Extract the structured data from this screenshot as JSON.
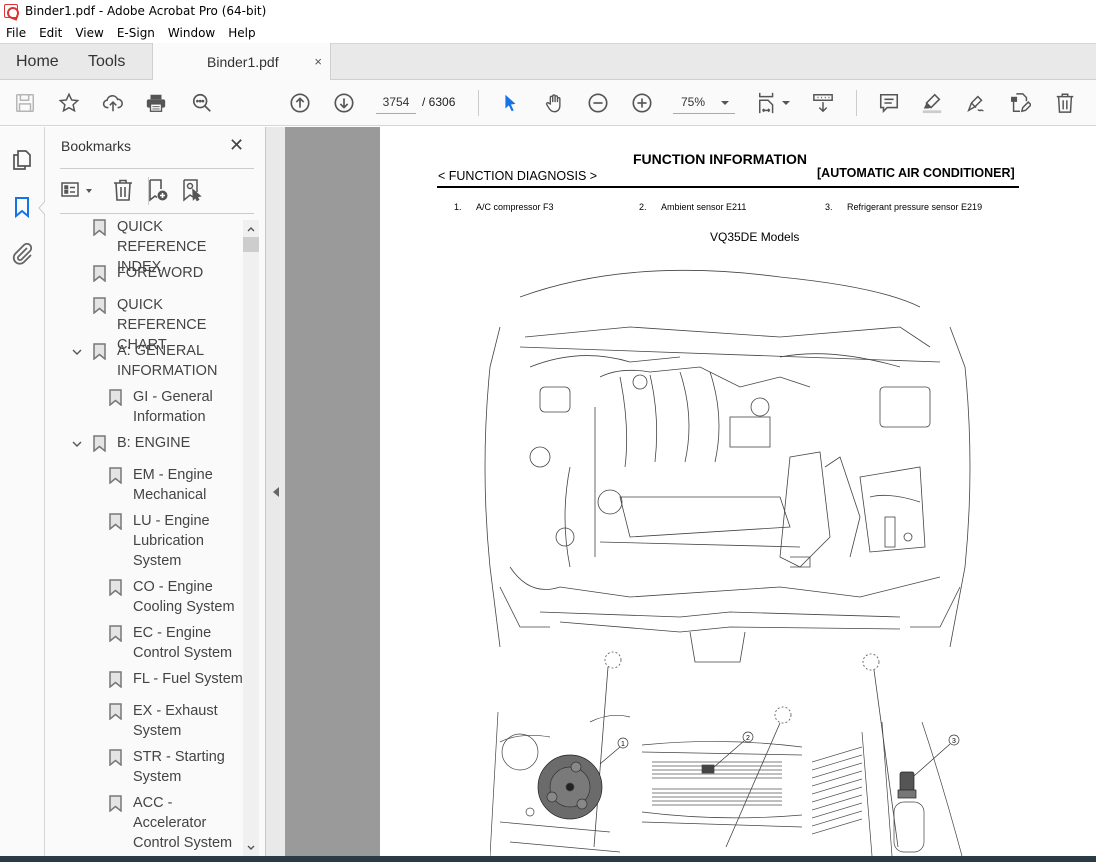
{
  "window": {
    "title": "Binder1.pdf - Adobe Acrobat Pro (64-bit)"
  },
  "menu": [
    "File",
    "Edit",
    "View",
    "E-Sign",
    "Window",
    "Help"
  ],
  "tabs": {
    "home": "Home",
    "tools": "Tools",
    "document": "Binder1.pdf",
    "close": "×"
  },
  "toolbar": {
    "current_page": "3754",
    "total_pages": "/  6306",
    "zoom": "75%",
    "icons": [
      "save-icon",
      "bookmark-star-icon",
      "upload-cloud-icon",
      "print-icon",
      "search-zoom-icon",
      "page-up-icon",
      "page-down-icon",
      "select-cursor-icon",
      "hand-icon",
      "zoom-out-icon",
      "zoom-in-icon",
      "fit-page-icon",
      "scroll-mode-icon",
      "comment-icon",
      "highlight-icon",
      "sign-icon",
      "edit-pdf-icon",
      "delete-icon"
    ]
  },
  "bookmarks": {
    "title": "Bookmarks",
    "close": "✕",
    "items": [
      {
        "label": "QUICK REFERENCE\nINDEX",
        "level": 0,
        "expandable": false
      },
      {
        "label": "FOREWORD",
        "level": 0,
        "expandable": false
      },
      {
        "label": "QUICK REFERENCE\nCHART",
        "level": 0,
        "expandable": false
      },
      {
        "label": "A: GENERAL\nINFORMATION",
        "level": 0,
        "expandable": true,
        "expanded": true
      },
      {
        "label": "GI - General\nInformation",
        "level": 1,
        "expandable": false
      },
      {
        "label": "B: ENGINE",
        "level": 0,
        "expandable": true,
        "expanded": true
      },
      {
        "label": "EM - Engine\nMechanical",
        "level": 1,
        "expandable": false
      },
      {
        "label": "LU - Engine\nLubrication\nSystem",
        "level": 1,
        "expandable": false
      },
      {
        "label": "CO - Engine\nCooling System",
        "level": 1,
        "expandable": false
      },
      {
        "label": "EC - Engine\nControl System",
        "level": 1,
        "expandable": false
      },
      {
        "label": "FL - Fuel System",
        "level": 1,
        "expandable": false
      },
      {
        "label": "EX - Exhaust\nSystem",
        "level": 1,
        "expandable": false
      },
      {
        "label": "STR - Starting\nSystem",
        "level": 1,
        "expandable": false
      },
      {
        "label": "ACC -\nAccelerator\nControl System",
        "level": 1,
        "expandable": false
      }
    ]
  },
  "document": {
    "title": "FUNCTION INFORMATION",
    "section_left": "< FUNCTION DIAGNOSIS >",
    "section_right": "[AUTOMATIC AIR CONDITIONER]",
    "legend": [
      {
        "num": "1.",
        "text": "A/C compressor F3"
      },
      {
        "num": "2.",
        "text": "Ambient sensor E211"
      },
      {
        "num": "3.",
        "text": "Refrigerant pressure sensor E219"
      }
    ],
    "subtitle": "VQ35DE Models",
    "callouts": [
      "1",
      "2",
      "3"
    ]
  },
  "colors": {
    "accent": "#1473e6",
    "app_icon": "#d33333",
    "viewer_bg": "#9a9a9a"
  }
}
